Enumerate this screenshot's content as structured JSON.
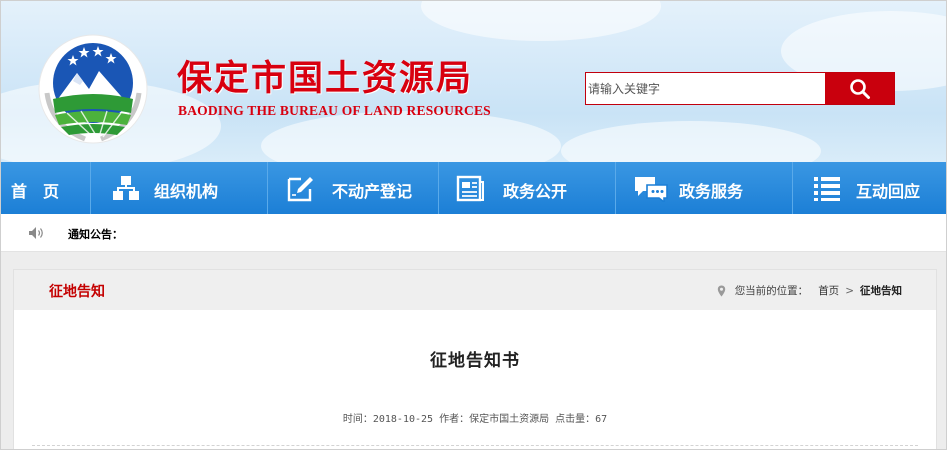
{
  "header": {
    "title": "保定市国土资源局",
    "subtitle": "BAODING THE BUREAU OF LAND RESOURCES",
    "search": {
      "placeholder": "请输入关键字",
      "value": ""
    },
    "colors": {
      "brand_red": "#d8000f",
      "sky": "#d3e8f8"
    }
  },
  "nav": {
    "items": [
      {
        "label": "首　页",
        "icon": ""
      },
      {
        "label": "组织机构",
        "icon": "org-chart-icon"
      },
      {
        "label": "不动产登记",
        "icon": "edit-document-icon"
      },
      {
        "label": "政务公开",
        "icon": "newspaper-icon"
      },
      {
        "label": "政务服务",
        "icon": "chat-bubbles-icon"
      },
      {
        "label": "互动回应",
        "icon": "list-icon"
      }
    ],
    "color": "#1c7fd6"
  },
  "notice": {
    "label": "通知公告："
  },
  "content": {
    "section_title": "征地告知",
    "location": {
      "prefix": "您当前的位置：",
      "home": "首页",
      "separator": ">",
      "current": "征地告知"
    },
    "article": {
      "title": "征地告知书",
      "meta": "时间：2018-10-25 作者：保定市国土资源局 点击量：67"
    }
  }
}
